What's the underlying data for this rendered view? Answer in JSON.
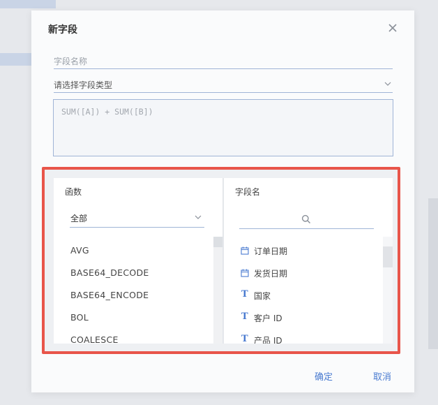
{
  "dialog": {
    "title": "新字段",
    "field_name_placeholder": "字段名称",
    "type_select_placeholder": "请选择字段类型",
    "formula_placeholder": "SUM([A]) + SUM([B])",
    "confirm_label": "确定",
    "cancel_label": "取消"
  },
  "functions_panel": {
    "title": "函数",
    "filter_value": "全部",
    "items": [
      "AVG",
      "BASE64_DECODE",
      "BASE64_ENCODE",
      "BOL",
      "COALESCE"
    ]
  },
  "fields_panel": {
    "title": "字段名",
    "items": [
      {
        "label": "订单日期",
        "icon": "calendar-icon"
      },
      {
        "label": "发货日期",
        "icon": "calendar-icon"
      },
      {
        "label": "国家",
        "icon": "text-type-icon",
        "glyph": "T"
      },
      {
        "label": "客户 ID",
        "icon": "text-type-icon",
        "glyph": "T"
      },
      {
        "label": "产品 ID",
        "icon": "text-type-icon",
        "glyph": "T"
      }
    ]
  },
  "colors": {
    "accent": "#4a7bd0",
    "highlight_border": "#e8554a",
    "underline": "#9fb4d6"
  }
}
